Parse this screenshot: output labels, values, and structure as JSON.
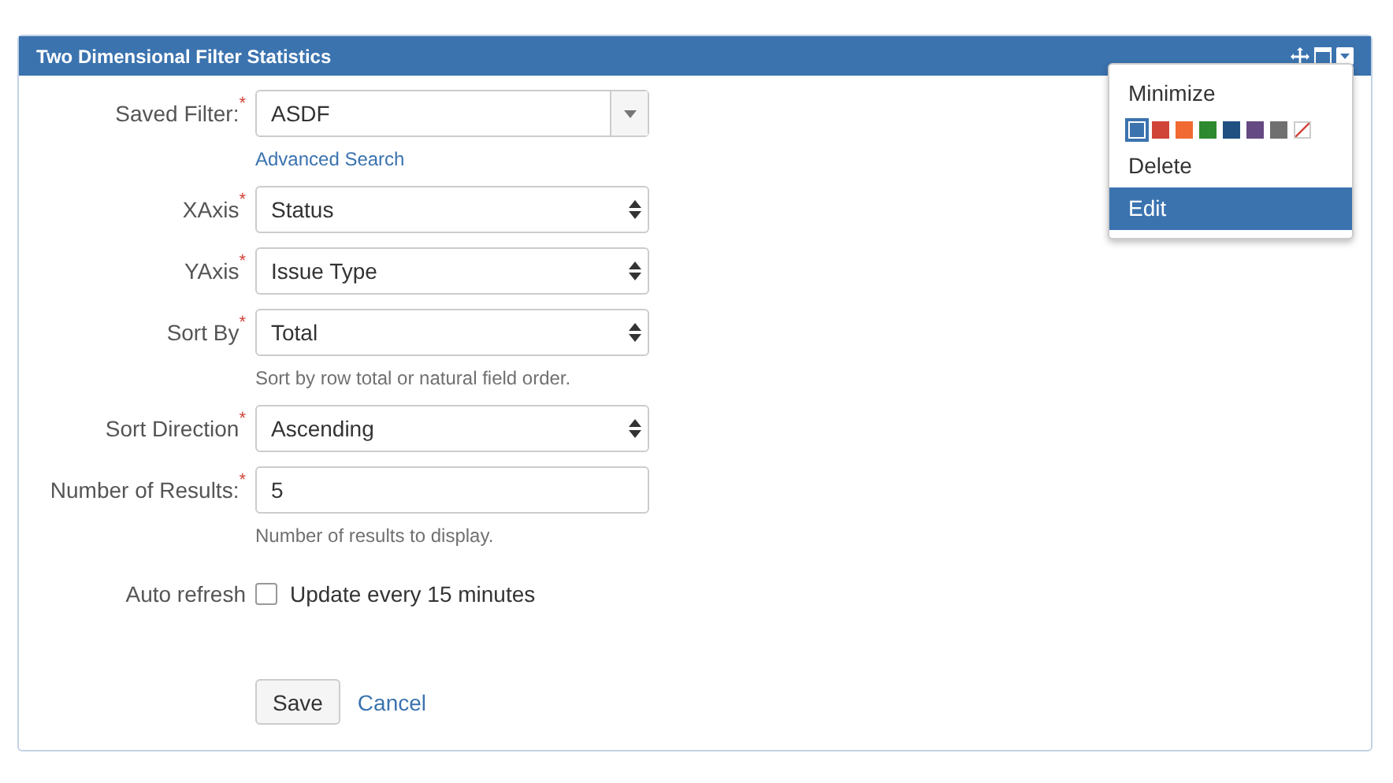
{
  "panel": {
    "title": "Two Dimensional Filter Statistics"
  },
  "form": {
    "fields": [
      {
        "kind": "combo",
        "label": "Saved Filter:",
        "required_mark": "*",
        "value": "ASDF",
        "link": "Advanced Search"
      },
      {
        "kind": "select",
        "label": "XAxis",
        "required_mark": "*",
        "value": "Status"
      },
      {
        "kind": "select",
        "label": "YAxis",
        "required_mark": "*",
        "value": "Issue Type"
      },
      {
        "kind": "select",
        "label": "Sort By",
        "required_mark": "*",
        "value": "Total",
        "help": "Sort by row total or natural field order."
      },
      {
        "kind": "select",
        "label": "Sort Direction",
        "required_mark": "*",
        "value": "Ascending"
      },
      {
        "kind": "text",
        "label": "Number of Results:",
        "required_mark": "*",
        "value": "5",
        "help": "Number of results to display."
      },
      {
        "kind": "checkbox",
        "label": "Auto refresh",
        "text": "Update every 15 minutes",
        "checked": false
      }
    ],
    "buttons": [
      {
        "kind": "button",
        "label": "Save"
      },
      {
        "kind": "link",
        "label": "Cancel"
      }
    ]
  },
  "menu": {
    "items": [
      {
        "kind": "item",
        "label": "Minimize",
        "selected": false
      },
      {
        "kind": "colors",
        "colors": [
          {
            "kind": "swatch",
            "color": "#3b73af",
            "selected": true
          },
          {
            "kind": "swatch",
            "color": "#d04437",
            "selected": false
          },
          {
            "kind": "swatch",
            "color": "#f06a31",
            "selected": false
          },
          {
            "kind": "swatch",
            "color": "#2e8a2e",
            "selected": false
          },
          {
            "kind": "swatch",
            "color": "#205081",
            "selected": false
          },
          {
            "kind": "swatch",
            "color": "#654982",
            "selected": false
          },
          {
            "kind": "swatch",
            "color": "#707070",
            "selected": false
          },
          {
            "kind": "none",
            "selected": false
          }
        ]
      },
      {
        "kind": "item",
        "label": "Delete",
        "selected": false
      },
      {
        "kind": "item",
        "label": "Edit",
        "selected": true
      }
    ]
  }
}
